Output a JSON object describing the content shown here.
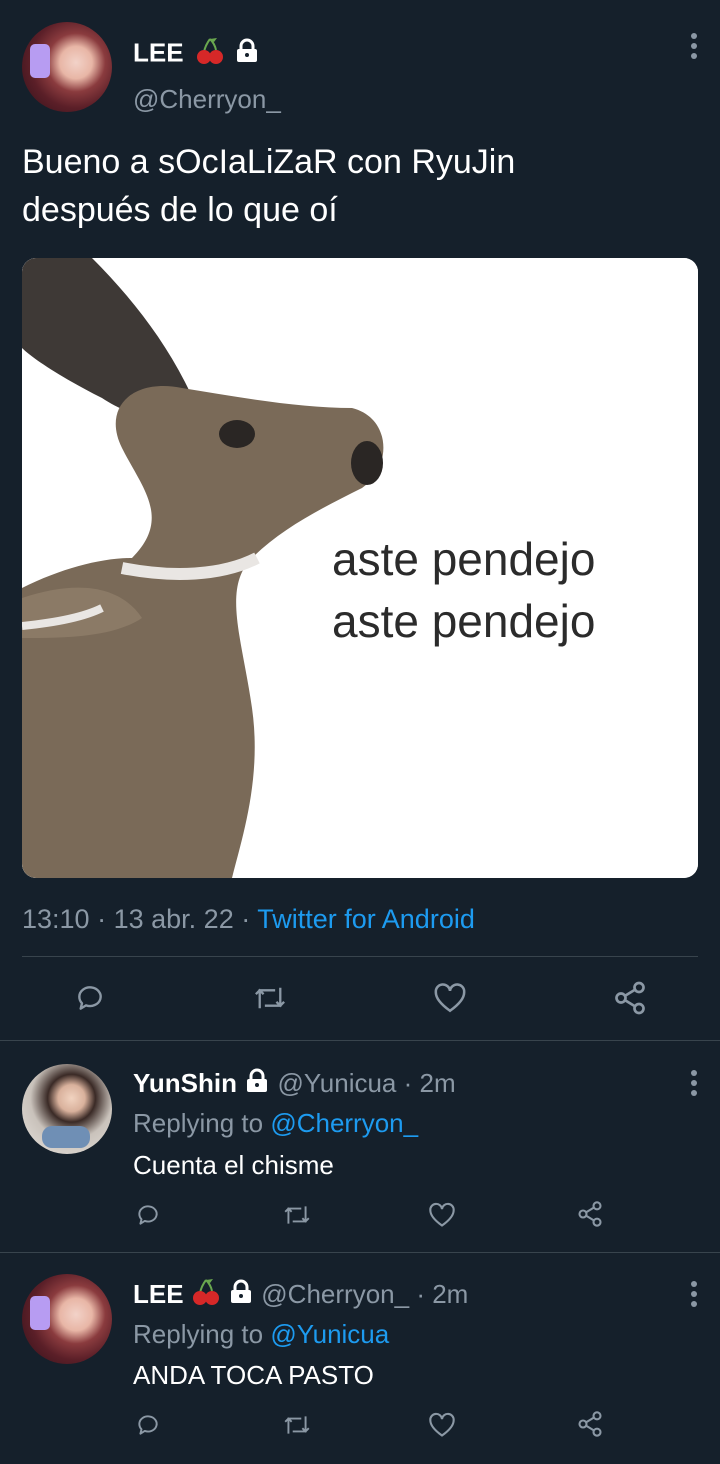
{
  "main_tweet": {
    "author_name": "LEE",
    "author_handle": "@Cherryon_",
    "text_line1": "Bueno a sOcIaLiZaR con RyuJin",
    "text_line2": "después de lo que oí",
    "media_text_line1": "aste pendejo",
    "media_text_line2": "aste pendejo",
    "time": "13:10",
    "separator": "·",
    "date": "13 abr. 22",
    "source": "Twitter for Android"
  },
  "replies": [
    {
      "author_name": "YunShin",
      "author_handle": "@Yunicua",
      "time": "· 2m",
      "replying_prefix": "Replying to",
      "replying_to": "@Cherryon_",
      "text": "Cuenta el chisme"
    },
    {
      "author_name": "LEE",
      "author_handle": "@Cherryon_",
      "time": "· 2m",
      "replying_prefix": "Replying to",
      "replying_to": "@Yunicua",
      "text": "ANDA TOCA PASTO"
    }
  ],
  "colors": {
    "background": "#15202b",
    "link": "#1d9bf0",
    "muted": "#8b98a5",
    "divider": "#38444d"
  },
  "icons": [
    "lock-icon",
    "cherry-icon",
    "more-icon",
    "reply-icon",
    "retweet-icon",
    "like-icon",
    "share-icon"
  ]
}
